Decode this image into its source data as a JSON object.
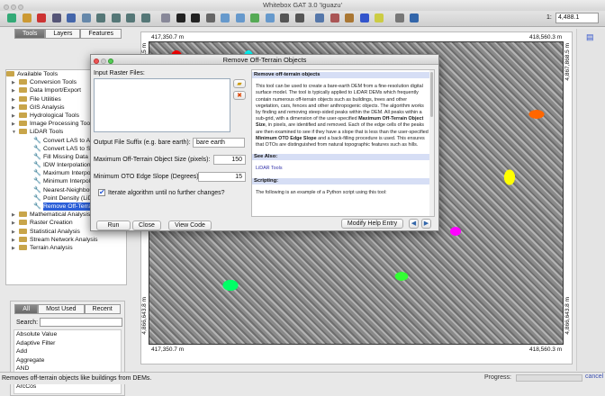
{
  "window": {
    "title": "Whitebox GAT 3.0 'Iguazu'"
  },
  "toolbar": {
    "scale_prefix": "1:",
    "scale_value": "4,488.1"
  },
  "left_tabs": [
    "Tools",
    "Layers",
    "Features"
  ],
  "tree": {
    "root": "Available Tools",
    "groups_before": [
      "Conversion Tools",
      "Data Import/Export",
      "File Utilities",
      "GIS Analysis",
      "Hydrological Tools",
      "Image Processing Tools",
      "LiDAR Tools"
    ],
    "lidar_tools": [
      "Convert LAS to ASCII (",
      "Convert LAS to Shapef",
      "Fill Missing Data Holes",
      "IDW Interpolation (LiDA",
      "Maximum Interpolation",
      "Minimum Interpolation",
      "Nearest-Neighbour In",
      "Point Density (LiDAR)",
      "Remove Off-Terrain O"
    ],
    "groups_after": [
      "Mathematical Analysis",
      "Raster Creation",
      "Statistical Analysis",
      "Stream Network Analysis",
      "Terrain Analysis"
    ]
  },
  "lower_tabs": [
    "All",
    "Most Used",
    "Recent"
  ],
  "search_label": "Search:",
  "tool_list": [
    "Absolute Value",
    "Adaptive Filter",
    "Add",
    "Aggregate",
    "AND",
    "Append",
    "ArcCos"
  ],
  "map": {
    "x_left": "417,350.7 m",
    "x_right": "418,560.3 m",
    "y_top": "4,867,868.5 m",
    "y_bottom": "4,866,643.8 m"
  },
  "status": {
    "message": "Removes off-terrain objects like buildings from DEMs.",
    "progress_label": "Progress:",
    "progress": 0,
    "cancel": "cancel"
  },
  "dialog": {
    "title": "Remove Off-Terrain Objects",
    "input_label": "Input Raster Files:",
    "suffix_label": "Output File Suffix (e.g. bare earth):",
    "suffix_value": "bare earth",
    "max_size_label": "Maximum Off-Terrain Object Size (pixels):",
    "max_size_value": "150",
    "min_slope_label": "Minimum OTO Edge Slope (Degrees):",
    "min_slope_value": "15",
    "iterate_label": "Iterate algorithm until no further changes?",
    "iterate_checked": true,
    "run": "Run",
    "close": "Close",
    "view_code": "View Code",
    "modify_help": "Modify Help Entry",
    "help": {
      "heading": "Remove off-terrain objects",
      "p1": "This tool can be used to create a bare-earth DEM from a fine-resolution digital surface model. The tool is typically applied to LiDAR DEMs which frequently contain numerous off-terrain objects such as buildings, trees and other vegetation, cars, fences and other anthropogenic objects. The algorithm works by finding and removing steep-sided peaks within the DEM. All peaks within a sub-grid, with a dimension of the user-specified ",
      "b1": "Maximum Off-Terrain Object Size",
      "p2": ", in pixels, are identified and removed. Each of the edge cells of the peaks are then examined to see if they have a slope that is less than the user-specified ",
      "b2": "Minimum OTO Edge Slope",
      "p3": " and a back-filling procedure is used. This ensures that OTOs are distinguished from natural topographic features such as hills.",
      "see_also": "See Also:",
      "link": "LiDAR Tools",
      "scripting": "Scripting:",
      "script_text": "The following is an example of a Python script using this tool:"
    }
  }
}
